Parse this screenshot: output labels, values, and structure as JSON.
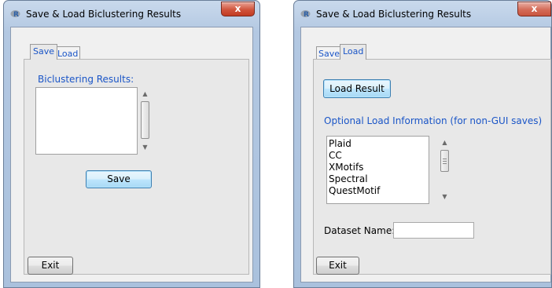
{
  "save_window": {
    "title": "Save & Load Biclustering Results",
    "close_label": "x",
    "tabs": [
      {
        "label": "Save"
      },
      {
        "label": "Load"
      }
    ],
    "results_label": "Biclustering Results:",
    "save_label": "Save",
    "exit_label": "Exit"
  },
  "load_window": {
    "title": "Save & Load Biclustering Results",
    "close_label": "x",
    "tabs": [
      {
        "label": "Save"
      },
      {
        "label": "Load"
      }
    ],
    "load_result_label": "Load Result",
    "optional_info_label": "Optional Load Information (for non-GUI saves)",
    "methods": [
      "Plaid",
      "CC",
      "XMotifs",
      "Spectral",
      "QuestMotif"
    ],
    "dataset_name_label": "Dataset Name:",
    "dataset_name_value": "",
    "exit_label": "Exit"
  },
  "colors": {
    "accent_text": "#1a55c7",
    "close_button": "#c7432b",
    "panel_bg": "#e8e8e8"
  }
}
